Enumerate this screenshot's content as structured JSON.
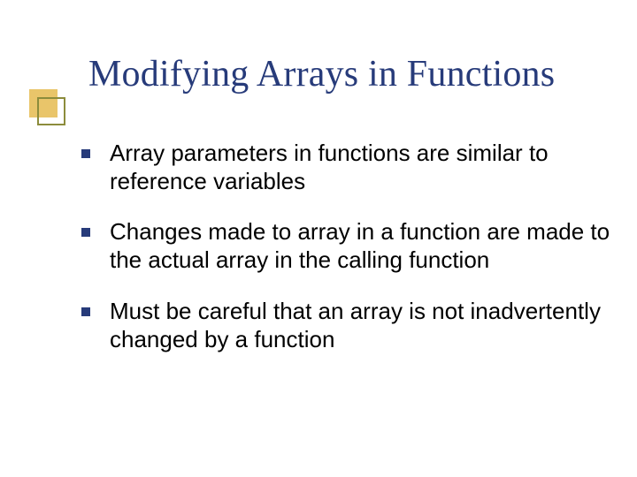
{
  "title": "Modifying Arrays in Functions",
  "bullets": [
    "Array parameters in functions are similar to reference variables",
    "Changes made to array in a function are made to the actual array in the calling function",
    "Must be careful that an array is not inadvertently changed by a function"
  ]
}
